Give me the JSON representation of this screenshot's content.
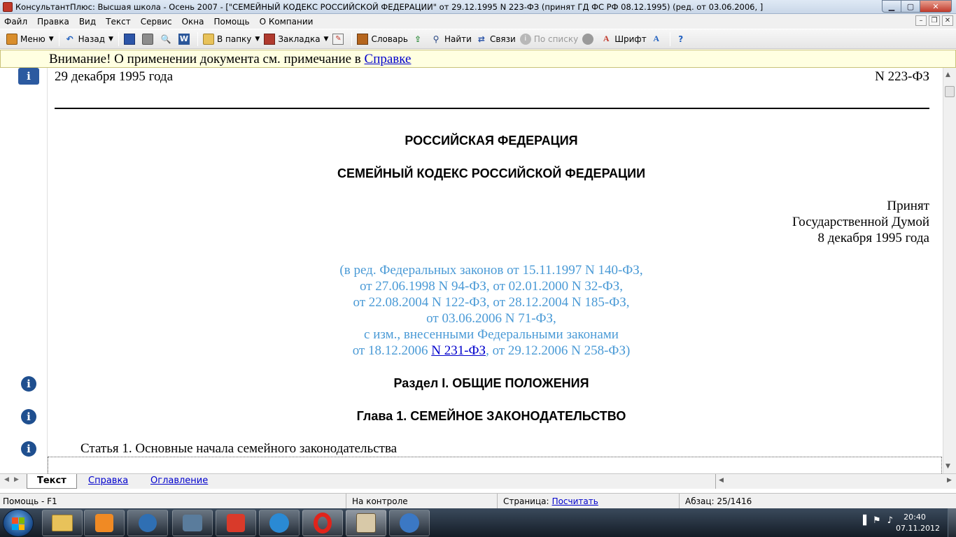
{
  "window": {
    "title": "КонсультантПлюс: Высшая школа - Осень 2007 - [\"СЕМЕЙНЫЙ КОДЕКС РОССИЙСКОЙ ФЕДЕРАЦИИ\" от 29.12.1995 N 223-ФЗ (принят ГД ФС РФ 08.12.1995) (ред. от 03.06.2006, ]"
  },
  "menu": {
    "items": [
      "Файл",
      "Правка",
      "Вид",
      "Текст",
      "Сервис",
      "Окна",
      "Помощь",
      "О Компании"
    ]
  },
  "toolbar": {
    "menu_label": "Меню",
    "back_label": "Назад",
    "folder_label": "В папку",
    "bookmark_label": "Закладка",
    "dictionary_label": "Словарь",
    "find_label": "Найти",
    "links_label": "Связи",
    "by_list_label": "По списку",
    "font_label": "Шрифт"
  },
  "notice": {
    "text": "Внимание! О применении документа см. примечание в ",
    "link": "Справке"
  },
  "document": {
    "date_left": "29 декабря 1995 года",
    "number_right": "N 223-ФЗ",
    "heading1": "РОССИЙСКАЯ ФЕДЕРАЦИЯ",
    "heading2": "СЕМЕЙНЫЙ КОДЕКС РОССИЙСКОЙ ФЕДЕРАЦИИ",
    "adopted": [
      "Принят",
      "Государственной Думой",
      "8 декабря 1995 года"
    ],
    "amendments": [
      "(в ред. Федеральных законов от 15.11.1997 N 140-ФЗ,",
      "от 27.06.1998 N 94-ФЗ, от 02.01.2000 N 32-ФЗ,",
      "от 22.08.2004 N 122-ФЗ, от 28.12.2004 N 185-ФЗ,",
      "от 03.06.2006 N 71-ФЗ,",
      "с изм., внесенными Федеральными законами"
    ],
    "amendments_last_prefix": "от 18.12.2006 ",
    "amendments_last_link": "N 231-ФЗ",
    "amendments_last_suffix": ", от 29.12.2006 N 258-ФЗ)",
    "section": "Раздел I. ОБЩИЕ ПОЛОЖЕНИЯ",
    "chapter": "Глава 1. СЕМЕЙНОЕ ЗАКОНОДАТЕЛЬСТВО",
    "article": "Статья 1. Основные начала семейного законодательства"
  },
  "tabs": {
    "text": "Текст",
    "help": "Справка",
    "contents": "Оглавление"
  },
  "status": {
    "help_hint": "Помощь - F1",
    "control": "На контроле",
    "page_label": "Страница:",
    "page_link": "Посчитать",
    "paragraph": "Абзац: 25/1416"
  },
  "taskbar": {
    "time": "20:40",
    "date": "07.11.2012"
  }
}
